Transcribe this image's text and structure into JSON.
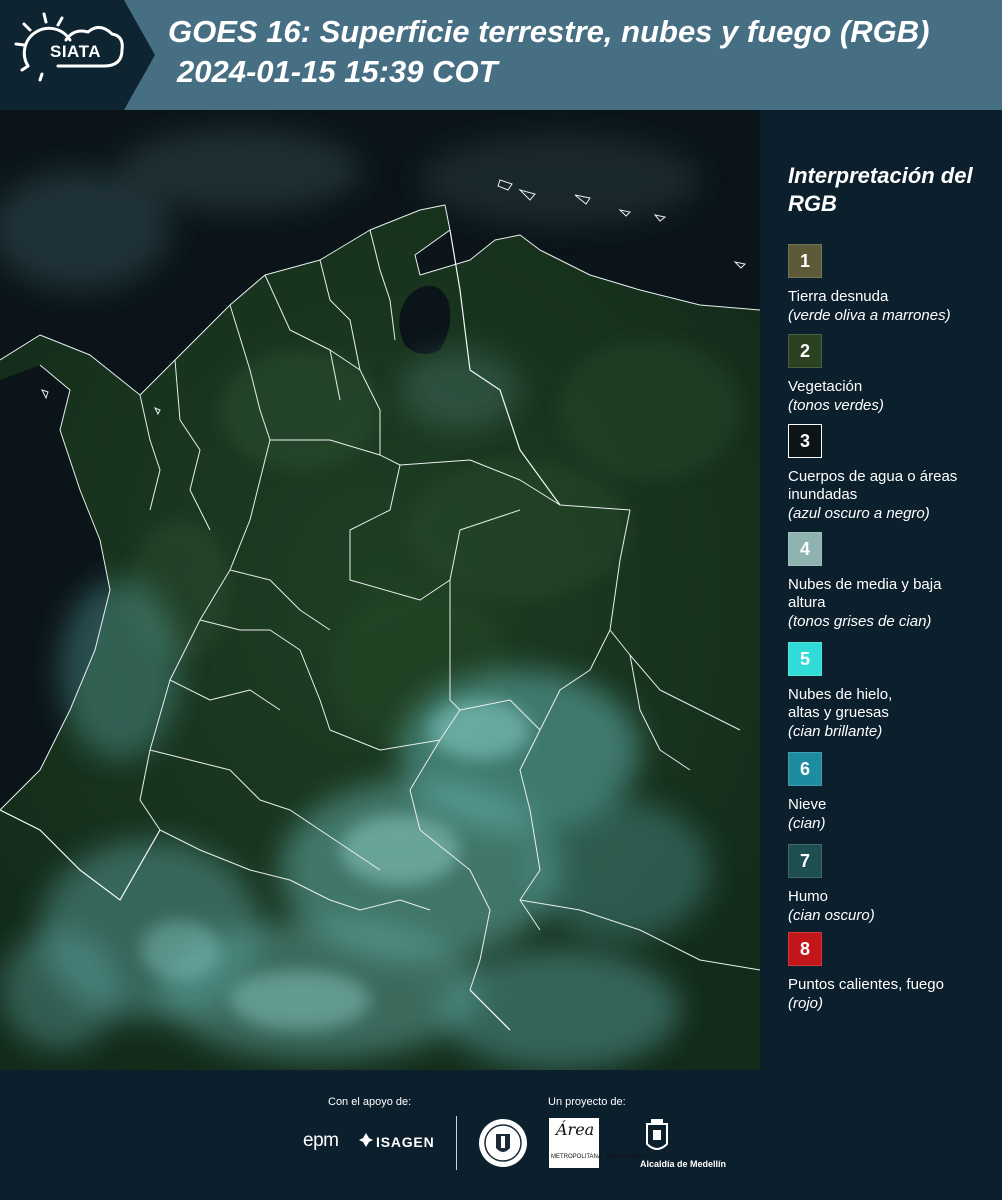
{
  "header": {
    "logo_text": "SIATA",
    "title_line1": "GOES 16: Superficie terrestre, nubes y fuego (RGB)",
    "title_line2": "2024-01-15 15:39 COT"
  },
  "legend": {
    "title": "Interpretación del RGB",
    "items": [
      {
        "number": "1",
        "color": "#5d5a3a",
        "label": "Tierra desnuda",
        "sub": "(verde oliva a marrones)"
      },
      {
        "number": "2",
        "color": "#2b4221",
        "label": "Vegetación",
        "sub": "(tonos verdes)"
      },
      {
        "number": "3",
        "color": "#0d1418",
        "label": "Cuerpos de agua o áreas inundadas",
        "sub": "(azul oscuro a negro)"
      },
      {
        "number": "4",
        "color": "#8fb3b0",
        "label": "Nubes de media y baja altura",
        "sub": "(tonos grises de cian)"
      },
      {
        "number": "5",
        "color": "#2fdcd7",
        "label": "Nubes de hielo, altas y gruesas",
        "sub": "(cian brillante)"
      },
      {
        "number": "6",
        "color": "#1e8ca0",
        "label": "Nieve",
        "sub": "(cian)"
      },
      {
        "number": "7",
        "color": "#1e4e4f",
        "label": "Humo",
        "sub": "(cian oscuro)"
      },
      {
        "number": "8",
        "color": "#c3161b",
        "label": "Puntos calientes, fuego",
        "sub": "(rojo)"
      }
    ]
  },
  "footer": {
    "support_label": "Con el apoyo de:",
    "project_label": "Un proyecto de:",
    "epm": "epm",
    "isagen": "ISAGEN",
    "area_script": "Área",
    "area_small": "METROPOLITANA · Valle de Aburrá",
    "alcaldia": "Alcaldía de Medellín"
  }
}
